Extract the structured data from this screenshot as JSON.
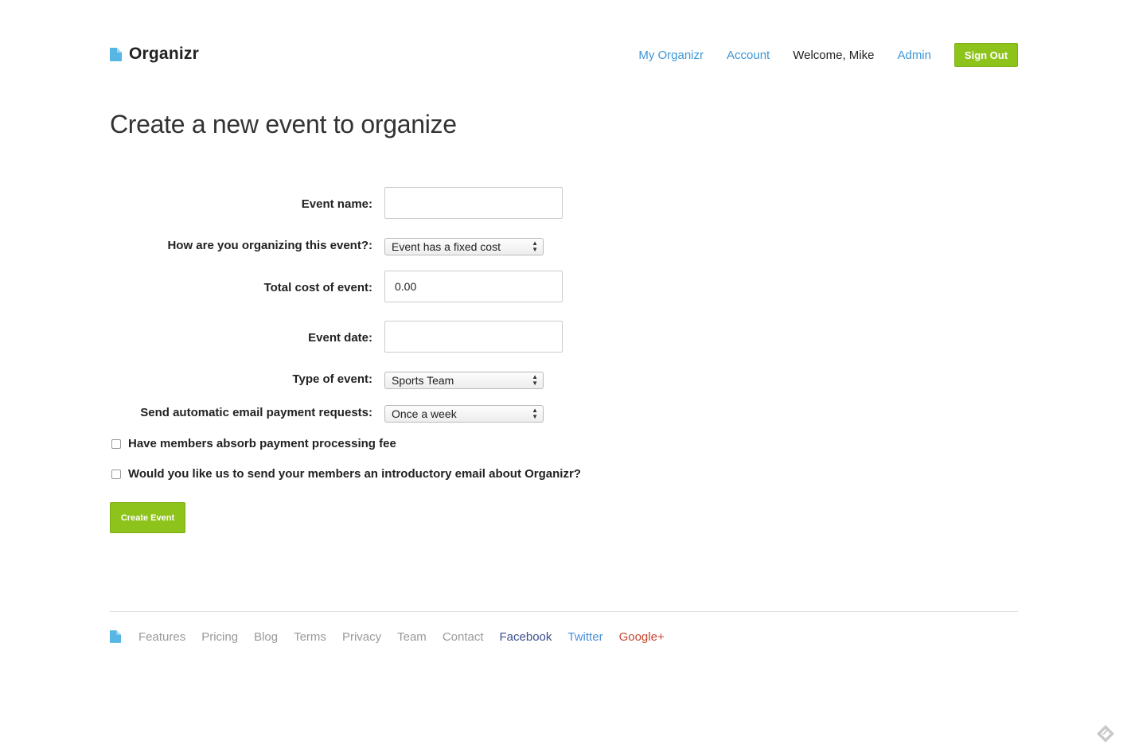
{
  "header": {
    "logo_text": "Organizr",
    "nav": {
      "my_organizr": "My Organizr",
      "account": "Account",
      "welcome": "Welcome, Mike",
      "admin": "Admin",
      "sign_out": "Sign Out"
    }
  },
  "page": {
    "title": "Create a new event to organize"
  },
  "form": {
    "event_name": {
      "label": "Event name:",
      "value": ""
    },
    "organizing": {
      "label": "How are you organizing this event?:",
      "selected": "Event has a fixed cost"
    },
    "total_cost": {
      "label": "Total cost of event:",
      "value": "0.00"
    },
    "event_date": {
      "label": "Event date:",
      "value": ""
    },
    "event_type": {
      "label": "Type of event:",
      "selected": "Sports Team"
    },
    "email_requests": {
      "label": "Send automatic email payment requests:",
      "selected": "Once a week"
    },
    "absorb_fee": {
      "label": "Have members absorb payment processing fee",
      "checked": false
    },
    "intro_email": {
      "label": "Would you like us to send your members an introductory email about Organizr?",
      "checked": false
    },
    "submit_label": "Create Event"
  },
  "footer": {
    "links": {
      "features": "Features",
      "pricing": "Pricing",
      "blog": "Blog",
      "terms": "Terms",
      "privacy": "Privacy",
      "team": "Team",
      "contact": "Contact",
      "facebook": "Facebook",
      "twitter": "Twitter",
      "google_plus": "Google+"
    }
  },
  "colors": {
    "accent_green": "#8ec31c",
    "link_blue": "#3d96d8",
    "footer_grey": "#999999",
    "facebook": "#3b4f8c",
    "twitter": "#4a8fd9",
    "google_plus": "#c4452f",
    "logo_blue": "#57b6e3"
  },
  "icons": {
    "logo": "document-icon",
    "footer_logo": "document-icon",
    "corner": "diamond-icon"
  }
}
